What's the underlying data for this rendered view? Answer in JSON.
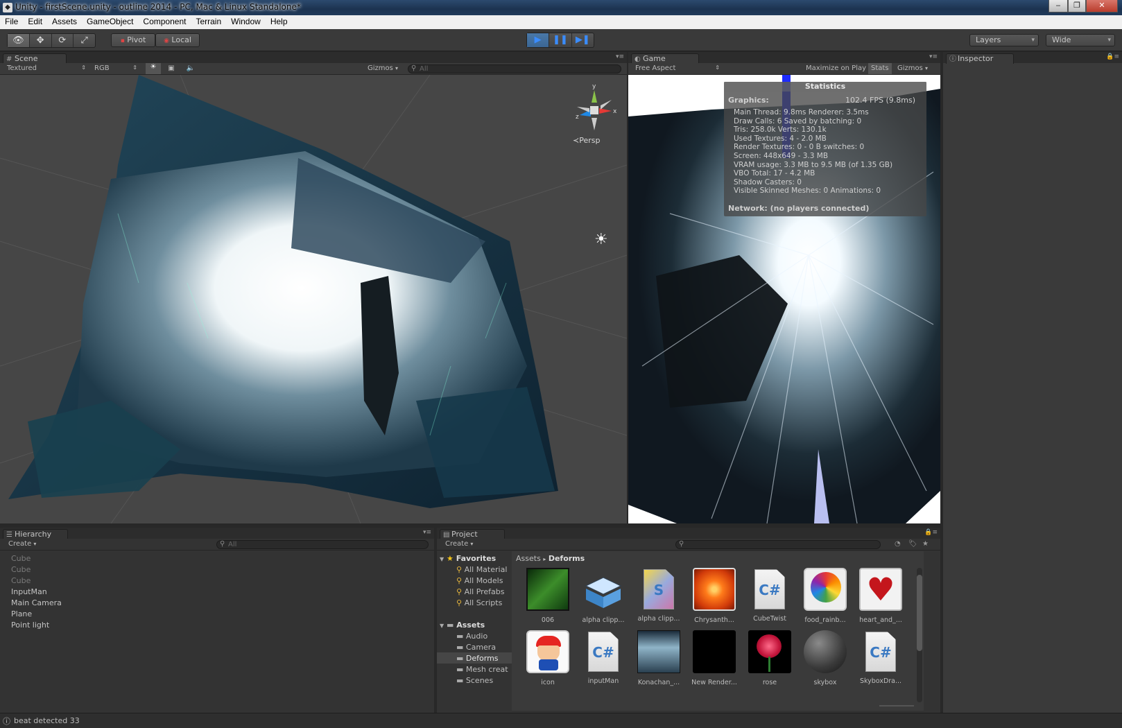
{
  "window": {
    "title": "Unity - firstScene.unity - outline 2014 - PC, Mac & Linux Standalone*",
    "app_icon": "unity-icon",
    "minimize": "‒",
    "restore": "❐",
    "close": "✕"
  },
  "menu": [
    "File",
    "Edit",
    "Assets",
    "GameObject",
    "Component",
    "Terrain",
    "Window",
    "Help"
  ],
  "toolbar": {
    "tools": [
      "hand-icon",
      "move-icon",
      "rotate-icon",
      "scale-icon"
    ],
    "pivot_label": "Pivot",
    "local_label": "Local",
    "play_controls": [
      "play-icon",
      "pause-icon",
      "step-icon"
    ],
    "layers_label": "Layers",
    "layout_label": "Wide"
  },
  "scene": {
    "tab_label": "Scene",
    "render_mode": "Textured",
    "color_mode": "RGB",
    "gizmos_label": "Gizmos",
    "search_placeholder": "All",
    "persp_label": "Persp",
    "axis_labels": {
      "x": "x",
      "y": "y",
      "z": "z"
    }
  },
  "game": {
    "tab_label": "Game",
    "aspect": "Free Aspect",
    "maximize_label": "Maximize on Play",
    "stats_label": "Stats",
    "gizmos_label": "Gizmos",
    "statistics": {
      "title": "Statistics",
      "graphics_label": "Graphics:",
      "fps": "102.4 FPS (9.8ms)",
      "lines": [
        "Main Thread: 9.8ms   Renderer: 3.5ms",
        "Draw Calls: 6   Saved by batching: 0",
        "Tris: 258.0k     Verts: 130.1k",
        "Used Textures: 4 - 2.0 MB",
        "Render Textures: 0 - 0 B   switches: 0",
        "Screen: 448x649 - 3.3 MB",
        "VRAM usage: 3.3 MB to 9.5 MB (of 1.35 GB)",
        "VBO Total: 17 - 4.2 MB",
        "Shadow Casters: 0",
        "Visible Skinned Meshes: 0      Animations: 0"
      ],
      "network": "Network: (no players connected)"
    }
  },
  "inspector": {
    "tab_label": "Inspector"
  },
  "hierarchy": {
    "tab_label": "Hierarchy",
    "create_label": "Create",
    "search_placeholder": "All",
    "items": [
      {
        "label": "Cube",
        "dim": true
      },
      {
        "label": "Cube",
        "dim": true
      },
      {
        "label": "Cube",
        "dim": true
      },
      {
        "label": "InputMan",
        "dim": false
      },
      {
        "label": "Main Camera",
        "dim": false
      },
      {
        "label": "Plane",
        "dim": false
      },
      {
        "label": "Point light",
        "dim": false
      }
    ]
  },
  "project": {
    "tab_label": "Project",
    "create_label": "Create",
    "favorites_label": "Favorites",
    "favorites": [
      "All Material",
      "All Models",
      "All Prefabs",
      "All Scripts"
    ],
    "assets_label": "Assets",
    "folders": [
      "Audio",
      "Camera",
      "Deforms",
      "Mesh creat",
      "Scenes"
    ],
    "selected_folder": "Deforms",
    "breadcrumb": [
      "Assets",
      "Deforms"
    ],
    "grid": [
      {
        "label": "006",
        "kind": "leaf"
      },
      {
        "label": "alpha clipp...",
        "kind": "prefab"
      },
      {
        "label": "alpha clipp...",
        "kind": "shader"
      },
      {
        "label": "Chrysanth...",
        "kind": "flower"
      },
      {
        "label": "CubeTwist",
        "kind": "script"
      },
      {
        "label": "food_rainb...",
        "kind": "lollipop"
      },
      {
        "label": "heart_and_...",
        "kind": "heart"
      },
      {
        "label": "icon",
        "kind": "mario"
      },
      {
        "label": "inputMan",
        "kind": "script"
      },
      {
        "label": "Konachan_...",
        "kind": "anime"
      },
      {
        "label": "New Render...",
        "kind": "black"
      },
      {
        "label": "rose",
        "kind": "rose"
      },
      {
        "label": "skybox",
        "kind": "sphere"
      },
      {
        "label": "SkyboxDra...",
        "kind": "script"
      }
    ]
  },
  "status": {
    "message": "beat detected 33"
  }
}
